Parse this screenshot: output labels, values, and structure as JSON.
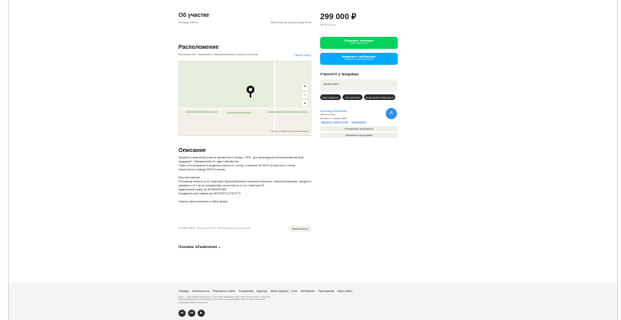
{
  "about": {
    "title": "Об участке",
    "area": "Площадь: 445 сот.",
    "distance": "Расстояние до центра города: 33 км"
  },
  "location": {
    "title": "Расположение",
    "address": "Ростовская обл., Тацинский р-н, Верхнеоблинское сельское поселение",
    "hide_map": "Скрыть карту",
    "zoom_in": "+",
    "zoom_out": "−",
    "map_attr": "© Яндекс Условия использования Карты"
  },
  "description": {
    "title": "Описание",
    "p1": "Продаётся земельный участок назначения 4 гектара - ВРИ: \"для производства сельскохозяйственной продукции\". Обременений нет, один собственник.",
    "p2": "Также есть возможность выделить участок в 1 гектар, стоимость 80 000 ₽ за участок в 1 гектар.",
    "p3": "Можно взять в аренду 5000 ₽ в месяц.",
    "p4": "Местоположение:",
    "p5": "Ростовская область, р-он Тацинский, Верхнеоблинское сельское поселение, х.Верхнеоблинский, находится",
    "p6": "примерно в 6.7 км по направлению на юго-восток от ул. Советская 33.",
    "p7": "Кадастровый номер 61:38:0600003:862",
    "p8": "Координаты для навигатора 48°19'35\"N 41°52'27\"E.",
    "p9": "Осмотр самостоятельно в любое время."
  },
  "meta": {
    "info": "№ 1239778879 · 25 августа 10:52 · 188 просмотров (+3 сегодня)",
    "complain": "Пожаловаться"
  },
  "similar": "Похожие объявления ⌄",
  "sidebar": {
    "price": "299 000 ₽",
    "price_per": "759 ₽ за сотку",
    "phone_btn": "Показать телефон",
    "phone_sub": "8 9XX XXX-XX-XX",
    "msg_btn": "Написать сообщение",
    "msg_sub": "Отвечает за несколько часов",
    "ask_title": "Спросите у продавца",
    "ask_placeholder": "Здравствуйте!",
    "chips": [
      "Ещё продаёте?",
      "Торг уместен?",
      "Когда можно посмотреть?"
    ],
    "seller_name": "Александр Евгеньевич",
    "seller_type": "Частное лицо",
    "seller_since": "На Авито с января 2022",
    "badge1": "Документы · 2000 м + 5 Бо",
    "badge2": "Самозанятый",
    "avatar_letter": "А",
    "ads_btn": "4 объявления пользователя",
    "subscribe_btn": "Подписаться на продавца"
  },
  "footer": {
    "links": [
      "Помощь",
      "Безопасность",
      "Реклама на сайте",
      "О компании",
      "Карьера",
      "Авито Журнал",
      "Блог",
      "#яПомогаю",
      "Приложение",
      "Карта сайта"
    ],
    "text": "Авито — сайт объявлений России. © ООО «КЕХ еКоммерц» 2007–2023. Правила Авито. Политика конфиденциальности. Оплачивая услуги на Авито, вы принимаете оферту. Авито использует рекомендательные технологии.",
    "socials": [
      "vk",
      "ok",
      "yt"
    ]
  }
}
